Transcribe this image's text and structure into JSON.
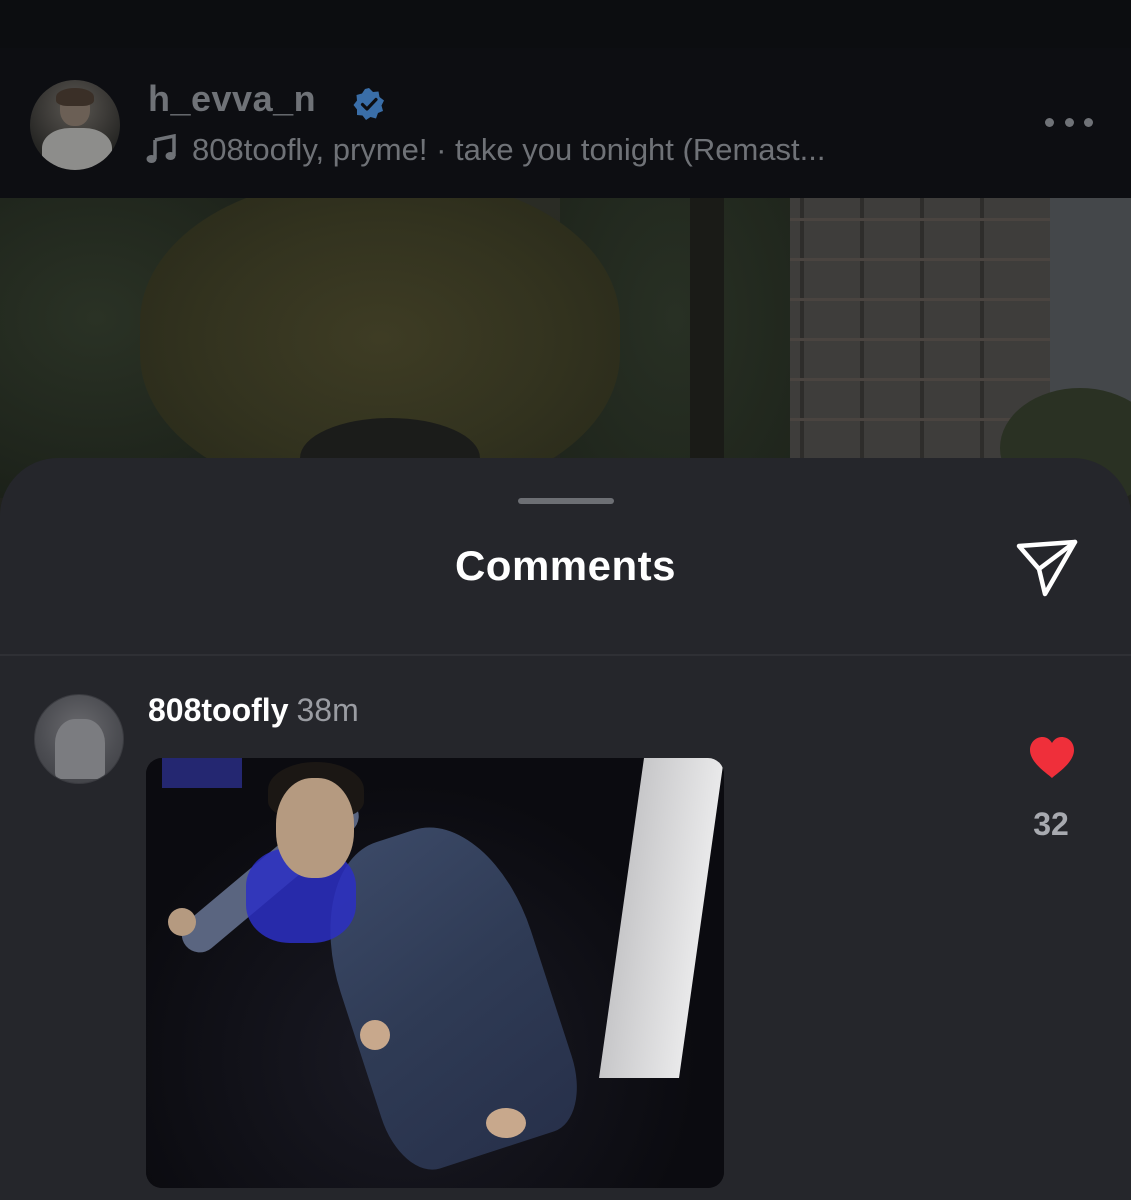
{
  "post": {
    "username": "h_evva_n",
    "verified": true,
    "music_icon": "music-note-icon",
    "music_text": "808toofly, pryme! · take you tonight (Remast...",
    "more_icon": "more-horizontal-icon"
  },
  "comments_sheet": {
    "title": "Comments",
    "share_icon": "paper-plane-icon",
    "comments": [
      {
        "username": "808toofly",
        "time": "38m",
        "attachment": "gif",
        "like_icon": "heart-icon",
        "liked": true,
        "like_count": "32"
      }
    ]
  },
  "colors": {
    "sheet_background": "#25262b",
    "verified_badge": "#3a6ea8",
    "like_red": "#ef2f3a",
    "muted_text": "#6f7277"
  }
}
